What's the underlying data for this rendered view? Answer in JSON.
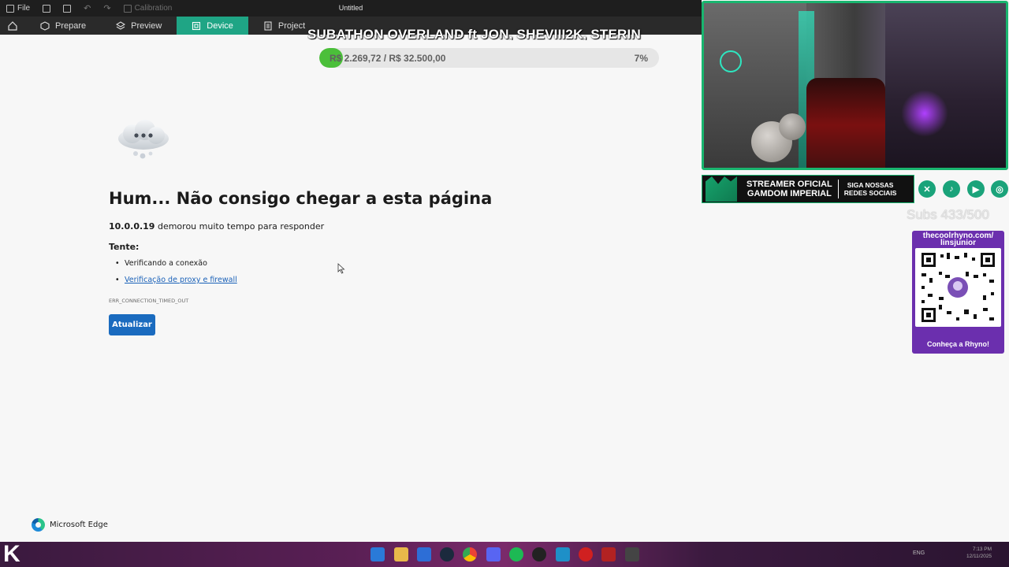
{
  "titlebar": {
    "file_label": "File",
    "calibration_label": "Calibration",
    "window_title": "Untitled"
  },
  "modebar": {
    "tabs": [
      {
        "label": "Prepare"
      },
      {
        "label": "Preview"
      },
      {
        "label": "Device",
        "active": true
      },
      {
        "label": "Project"
      }
    ]
  },
  "overlay": {
    "title": "SUBATHON OVERLAND ft JON, SHEVIII2K, STERIN",
    "goal_text": "R$ 2.269,72 / R$ 32.500,00",
    "goal_percent_label": "7%",
    "goal_fraction": 0.07
  },
  "error_page": {
    "heading": "Hum... Não consigo chegar a esta página",
    "host": "10.0.0.19",
    "message": "demorou muito tempo para responder",
    "try_label": "Tente:",
    "suggestions": [
      "Verificando a conexão",
      "Verificação de proxy e firewall"
    ],
    "error_code": "ERR_CONNECTION_TIMED_OUT",
    "refresh_button": "Atualizar",
    "brand": "Microsoft Edge"
  },
  "stream": {
    "banner_main_line1": "STREAMER OFICIAL",
    "banner_main_line2": "GAMDOM IMPERIAL",
    "banner_side_line1": "SIGA NOSSAS",
    "banner_side_line2": "REDES SOCIAIS",
    "subs": "Subs 433/500",
    "qr_url_line1": "thecoolrhyno.com/",
    "qr_url_line2": "linsjunior",
    "qr_caption": "Conheça a Rhyno!"
  },
  "taskbar": {
    "tray_lang": "ENG",
    "clock_time": "7:13 PM",
    "clock_date": "12/11/2025"
  },
  "colors": {
    "accent": "#1fa585",
    "link": "#1a61b8",
    "button": "#1a6bbf",
    "goal_fill": "#4bbf3a",
    "qr_card": "#6b2fae"
  }
}
